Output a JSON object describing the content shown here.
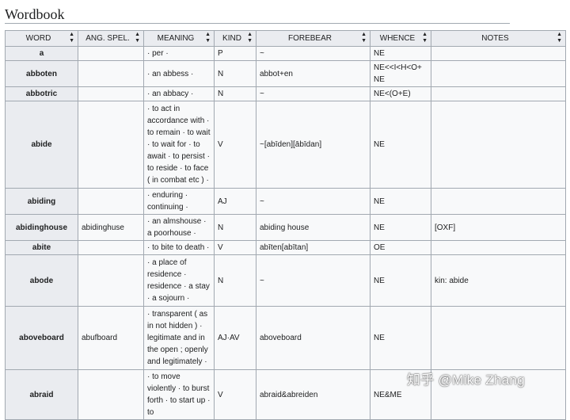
{
  "heading": "Wordbook",
  "table": {
    "columns": [
      "WORD",
      "ANG. SPEL.",
      "MEANING",
      "KIND",
      "FOREBEAR",
      "WHENCE",
      "NOTES"
    ],
    "rows": [
      {
        "word": "a",
        "ang": "",
        "meaning": "· per ·",
        "kind": "P",
        "forebear": "~",
        "whence": "NE",
        "notes": ""
      },
      {
        "word": "abboten",
        "ang": "",
        "meaning": "· an abbess ·",
        "kind": "N",
        "forebear": "abbot+en",
        "whence": "NE<<I<H<O+NE",
        "notes": ""
      },
      {
        "word": "abbotric",
        "ang": "",
        "meaning": "· an abbacy ·",
        "kind": "N",
        "forebear": "~",
        "whence": "NE<(O+E)",
        "notes": ""
      },
      {
        "word": "abide",
        "ang": "",
        "meaning": "· to act in accordance with · to remain · to wait · to wait for · to await · to persist · to reside · to face ( in combat etc ) ·",
        "kind": "V",
        "forebear": "~[abīden][ābīdan]",
        "whence": "NE",
        "notes": ""
      },
      {
        "word": "abiding",
        "ang": "",
        "meaning": "· enduring · continuing ·",
        "kind": "AJ",
        "forebear": "~",
        "whence": "NE",
        "notes": ""
      },
      {
        "word": "abidinghouse",
        "ang": "abidinghuse",
        "meaning": "· an almshouse · a poorhouse ·",
        "kind": "N",
        "forebear": "abiding house",
        "whence": "NE",
        "notes": "[OXF]"
      },
      {
        "word": "abite",
        "ang": "",
        "meaning": "· to bite to death ·",
        "kind": "V",
        "forebear": "abīten[abītan]",
        "whence": "OE",
        "notes": ""
      },
      {
        "word": "abode",
        "ang": "",
        "meaning": "· a place of residence · residence · a stay · a sojourn ·",
        "kind": "N",
        "forebear": "~",
        "whence": "NE",
        "notes": "kin: abide"
      },
      {
        "word": "aboveboard",
        "ang": "abufboard",
        "meaning": "· transparent ( as in not hidden ) · legitimate and in the open ; openly and legitimately ·",
        "kind": "AJ·AV",
        "forebear": "aboveboard",
        "whence": "NE",
        "notes": ""
      },
      {
        "word": "abraid",
        "ang": "",
        "meaning": "· to move violently · to burst forth · to start up · to",
        "kind": "V",
        "forebear": "abraid&abreiden",
        "whence": "NE&ME",
        "notes": ""
      }
    ]
  },
  "watermark": "知乎 @Mike Zhang"
}
